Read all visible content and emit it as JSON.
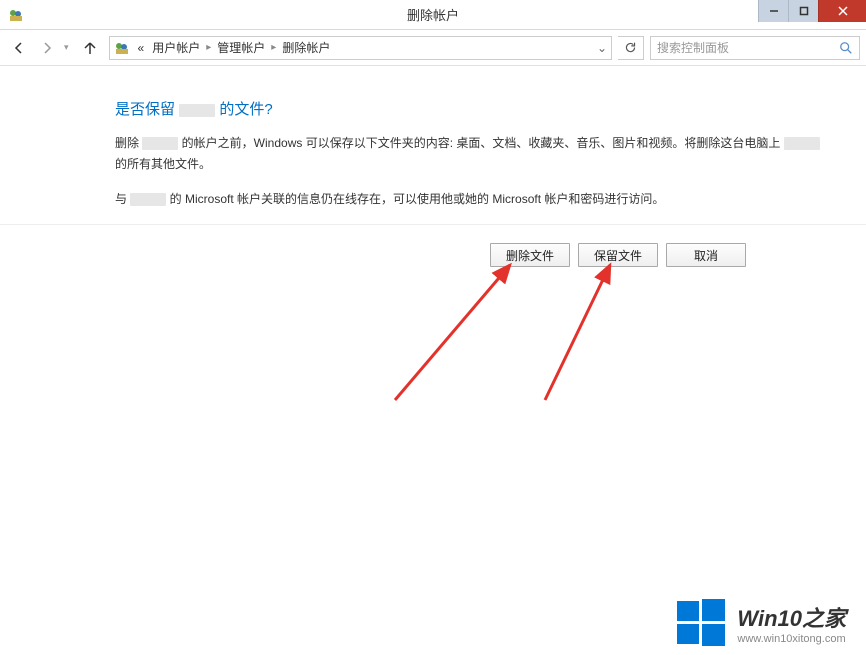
{
  "window": {
    "title": "删除帐户",
    "controls": {
      "minimize": "–",
      "maximize": "▢",
      "close": "×"
    }
  },
  "nav": {
    "breadcrumb_prefix": "«",
    "crumbs": [
      "用户帐户",
      "管理帐户",
      "删除帐户"
    ],
    "search_placeholder": "搜索控制面板"
  },
  "content": {
    "heading_prefix": "是否保留 ",
    "heading_suffix": " 的文件?",
    "para1_a": "删除 ",
    "para1_b": " 的帐户之前，Windows 可以保存以下文件夹的内容: 桌面、文档、收藏夹、音乐、图片和视频。将删除这台电脑上 ",
    "para1_c": " 的所有其他文件。",
    "para2_a": "与 ",
    "para2_b": " 的 Microsoft 帐户关联的信息仍在线存在，可以使用他或她的 Microsoft 帐户和密码进行访问。"
  },
  "buttons": {
    "delete_files": "删除文件",
    "keep_files": "保留文件",
    "cancel": "取消"
  },
  "watermark": {
    "title": "Win10之家",
    "url": "www.win10xitong.com"
  }
}
